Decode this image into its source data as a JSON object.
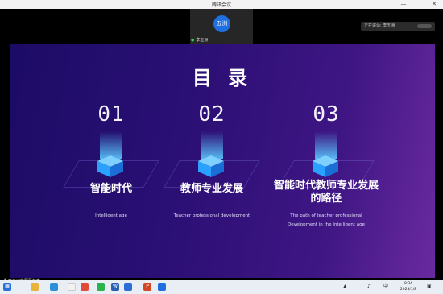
{
  "window": {
    "title": "腾讯会议",
    "minimize": "—",
    "maximize": "□",
    "close": "✕"
  },
  "participant": {
    "avatar_text": "五洲",
    "name": "李五洲",
    "mic_icon": "mic-icon"
  },
  "speaking": {
    "label": "正在讲话: 李五洲"
  },
  "slide": {
    "title": "目 录",
    "items": [
      {
        "number": "01",
        "title": "智能时代",
        "subtitle_lines": [
          "Intelligent age"
        ]
      },
      {
        "number": "02",
        "title": "教师专业发展",
        "subtitle_lines": [
          "Teacher professional development"
        ]
      },
      {
        "number": "03",
        "title_lines": [
          "智能时代教师专业发展",
          "的路径"
        ],
        "subtitle_lines": [
          "The path of teacher professional",
          "Development in the Intelligent age"
        ]
      }
    ]
  },
  "status": {
    "share_text": "李五洲的屏幕共享"
  },
  "taskbar": {
    "apps": [
      "windows-start-icon",
      "search-icon",
      "file-explorer-icon",
      "edge-icon",
      "chrome-icon",
      "chat-icon",
      "media-icon",
      "photos-icon",
      "wechat-icon",
      "word-icon",
      "excel-icon",
      "powerpoint-icon",
      "tencent-meeting-icon"
    ],
    "tray_lang": "中",
    "time": "8:34",
    "date": "2023/1/8"
  },
  "colors": {
    "accent": "#1f6fe0",
    "cube": "#2aa0ff",
    "slide_start": "#1c0c66",
    "slide_end": "#6a2aa0"
  }
}
